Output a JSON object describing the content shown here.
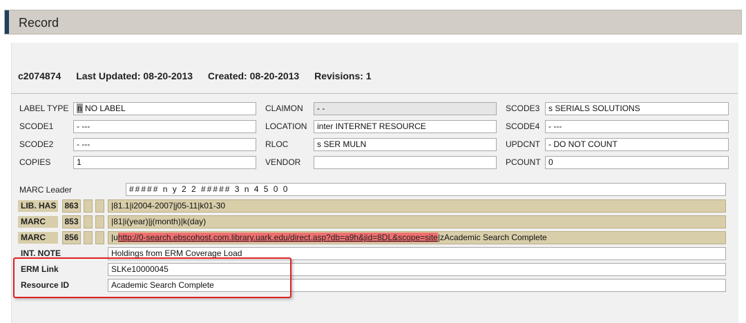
{
  "window": {
    "title": "Record"
  },
  "record": {
    "id": "c2074874",
    "last_updated": "Last Updated: 08-20-2013",
    "created": "Created: 08-20-2013",
    "revisions": "Revisions: 1"
  },
  "fixed_fields": {
    "label_type": {
      "label": "LABEL TYPE",
      "code": "n",
      "value": " NO LABEL"
    },
    "claimon": {
      "label": "CLAIMON",
      "value": "-  -"
    },
    "scode3": {
      "label": "SCODE3",
      "value": "s  SERIALS SOLUTIONS"
    },
    "scode1": {
      "label": "SCODE1",
      "value": "-  ---"
    },
    "location": {
      "label": "LOCATION",
      "value": "inter  INTERNET RESOURCE"
    },
    "scode4": {
      "label": "SCODE4",
      "value": "-  ---"
    },
    "scode2": {
      "label": "SCODE2",
      "value": "-  ---"
    },
    "rloc": {
      "label": "RLOC",
      "value": "s  SER MULN"
    },
    "updcnt": {
      "label": "UPDCNT",
      "value": "-  DO NOT COUNT"
    },
    "copies": {
      "label": "COPIES",
      "value": "1"
    },
    "vendor": {
      "label": "VENDOR",
      "value": ""
    },
    "pcount": {
      "label": "PCOUNT",
      "value": "0"
    }
  },
  "marc_leader": {
    "label": "MARC Leader",
    "value": "#####  n y     2 2 #####  3 n    4 5 0 0"
  },
  "var_fields": {
    "lib_has": {
      "label": "LIB. HAS",
      "tag": "863",
      "value": "|81.1|i2004-2007|j05-11|k01-30"
    },
    "marc_853": {
      "label": "MARC",
      "tag": "853",
      "value": "|81|i(year)|j(month)|k(day)"
    },
    "marc_856": {
      "label": "MARC",
      "tag": "856",
      "prefix": "|u",
      "url": "http://0-search.ebscohost.com.library.uark.edu/direct.asp?db=a9h&jid=8DL&scope=site",
      "suffix": "|zAcademic Search Complete"
    },
    "int_note": {
      "label": "INT. NOTE",
      "value": "Holdings from ERM Coverage Load"
    },
    "erm_link": {
      "label": "ERM Link",
      "value": "SLKe10000045"
    },
    "resource_id": {
      "label": "Resource ID",
      "value": "Academic Search Complete"
    }
  },
  "colors": {
    "title_bar": "#d3cdc7",
    "accent": "#1f3f5f",
    "var_field_bg": "#d8ceaa",
    "url_highlight": "#f07070",
    "annotation_box": "#e02020"
  }
}
